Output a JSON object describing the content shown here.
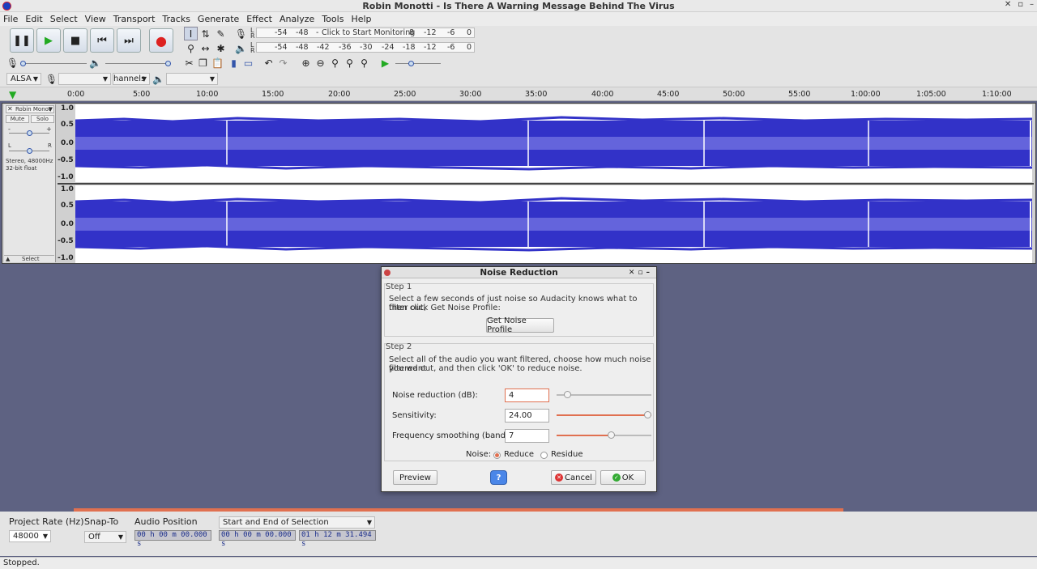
{
  "window": {
    "title": "Robin Monotti - Is There A Warning Message Behind The Virus",
    "controls": [
      "✕",
      "▫",
      "–"
    ]
  },
  "menu": [
    "File",
    "Edit",
    "Select",
    "View",
    "Transport",
    "Tracks",
    "Generate",
    "Effect",
    "Analyze",
    "Tools",
    "Help"
  ],
  "transport": {
    "icons": [
      "pause-icon",
      "play-icon",
      "stop-icon",
      "skip-start-icon",
      "skip-end-icon",
      "record-icon"
    ]
  },
  "meters": {
    "record_labels": [
      "-54",
      "-48",
      "-",
      "Click to Start Monitoring",
      "8",
      "-12",
      "-6",
      "0"
    ],
    "playback_labels": [
      "-54",
      "-48",
      "-42",
      "-36",
      "-30",
      "-24",
      "-18",
      "-12",
      "-6",
      "0"
    ],
    "L": "L",
    "R": "R"
  },
  "device": {
    "host": "ALSA",
    "record_device": "",
    "channels": "hannels",
    "playback_device": ""
  },
  "ruler": {
    "ticks": [
      "0:00",
      "5:00",
      "10:00",
      "15:00",
      "20:00",
      "25:00",
      "30:00",
      "35:00",
      "40:00",
      "45:00",
      "50:00",
      "55:00",
      "1:00:00",
      "1:05:00",
      "1:10:00"
    ]
  },
  "track": {
    "name": "Robin Monot",
    "mute": "Mute",
    "solo": "Solo",
    "gain_minus": "-",
    "gain_plus": "+",
    "pan_left": "L",
    "pan_right": "R",
    "info_line1": "Stereo, 48000Hz",
    "info_line2": "32-bit float",
    "select": "Select",
    "scale": [
      "1.0",
      "0.5",
      "0.0",
      "-0.5",
      "-1.0"
    ]
  },
  "dialog": {
    "title": "Noise Reduction",
    "step1_title": "Step 1",
    "step1_text1": "Select a few seconds of just noise so Audacity knows what to filter out,",
    "step1_text2": "then click Get Noise Profile:",
    "get_profile": "Get Noise Profile",
    "step2_title": "Step 2",
    "step2_text1": "Select all of the audio you want filtered, choose how much noise you want",
    "step2_text2": "filtered out, and then click 'OK' to reduce noise.",
    "noise_reduction_label": "Noise reduction (dB):",
    "noise_reduction_value": "4",
    "noise_reduction_level": 0.08,
    "sensitivity_label": "Sensitivity:",
    "sensitivity_value": "24.00",
    "sensitivity_level": 1.0,
    "smoothing_label": "Frequency smoothing (bands):",
    "smoothing_value": "7",
    "smoothing_level": 0.58,
    "noise_label": "Noise:",
    "reduce_label": "Reduce",
    "residue_label": "Residue",
    "preview": "Preview",
    "help": "?",
    "cancel": "Cancel",
    "ok": "OK"
  },
  "bottom": {
    "project_rate_label": "Project Rate (Hz)",
    "project_rate_value": "48000",
    "snap_label": "Snap-To",
    "snap_value": "Off",
    "audio_position_label": "Audio Position",
    "audio_position_value": "00 h 00 m 00.000 s",
    "selection_mode": "Start and End of Selection",
    "selection_start": "00 h 00 m 00.000 s",
    "selection_end": "01 h 12 m 31.494 s"
  },
  "status": "Stopped."
}
